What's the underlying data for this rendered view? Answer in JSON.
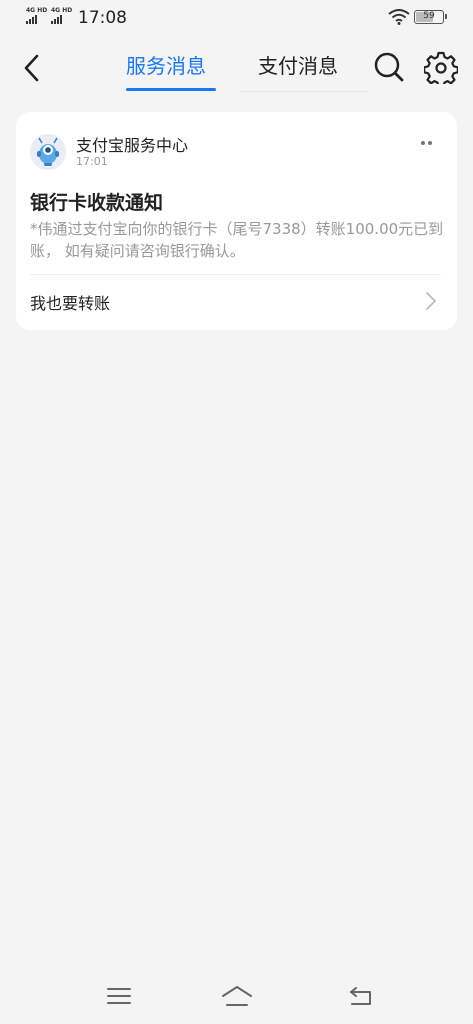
{
  "status_bar": {
    "signal_1": "4G HD",
    "signal_2": "4G HD",
    "time": "17:08",
    "battery": "59"
  },
  "header": {
    "tab_active": "服务消息",
    "tab_inactive": "支付消息"
  },
  "message": {
    "sender": "支付宝服务中心",
    "time": "17:01",
    "title": "银行卡收款通知",
    "body": "*伟通过支付宝向你的银行卡（尾号7338）转账100.00元已到账， 如有疑问请咨询银行确认。",
    "action": "我也要转账"
  },
  "colors": {
    "accent": "#1677ff",
    "background": "#f4f4f4",
    "card": "#ffffff"
  },
  "icons": [
    "back-icon",
    "search-icon",
    "gear-icon",
    "more-icon",
    "chevron-right-icon",
    "menu-icon",
    "home-icon",
    "return-icon"
  ]
}
